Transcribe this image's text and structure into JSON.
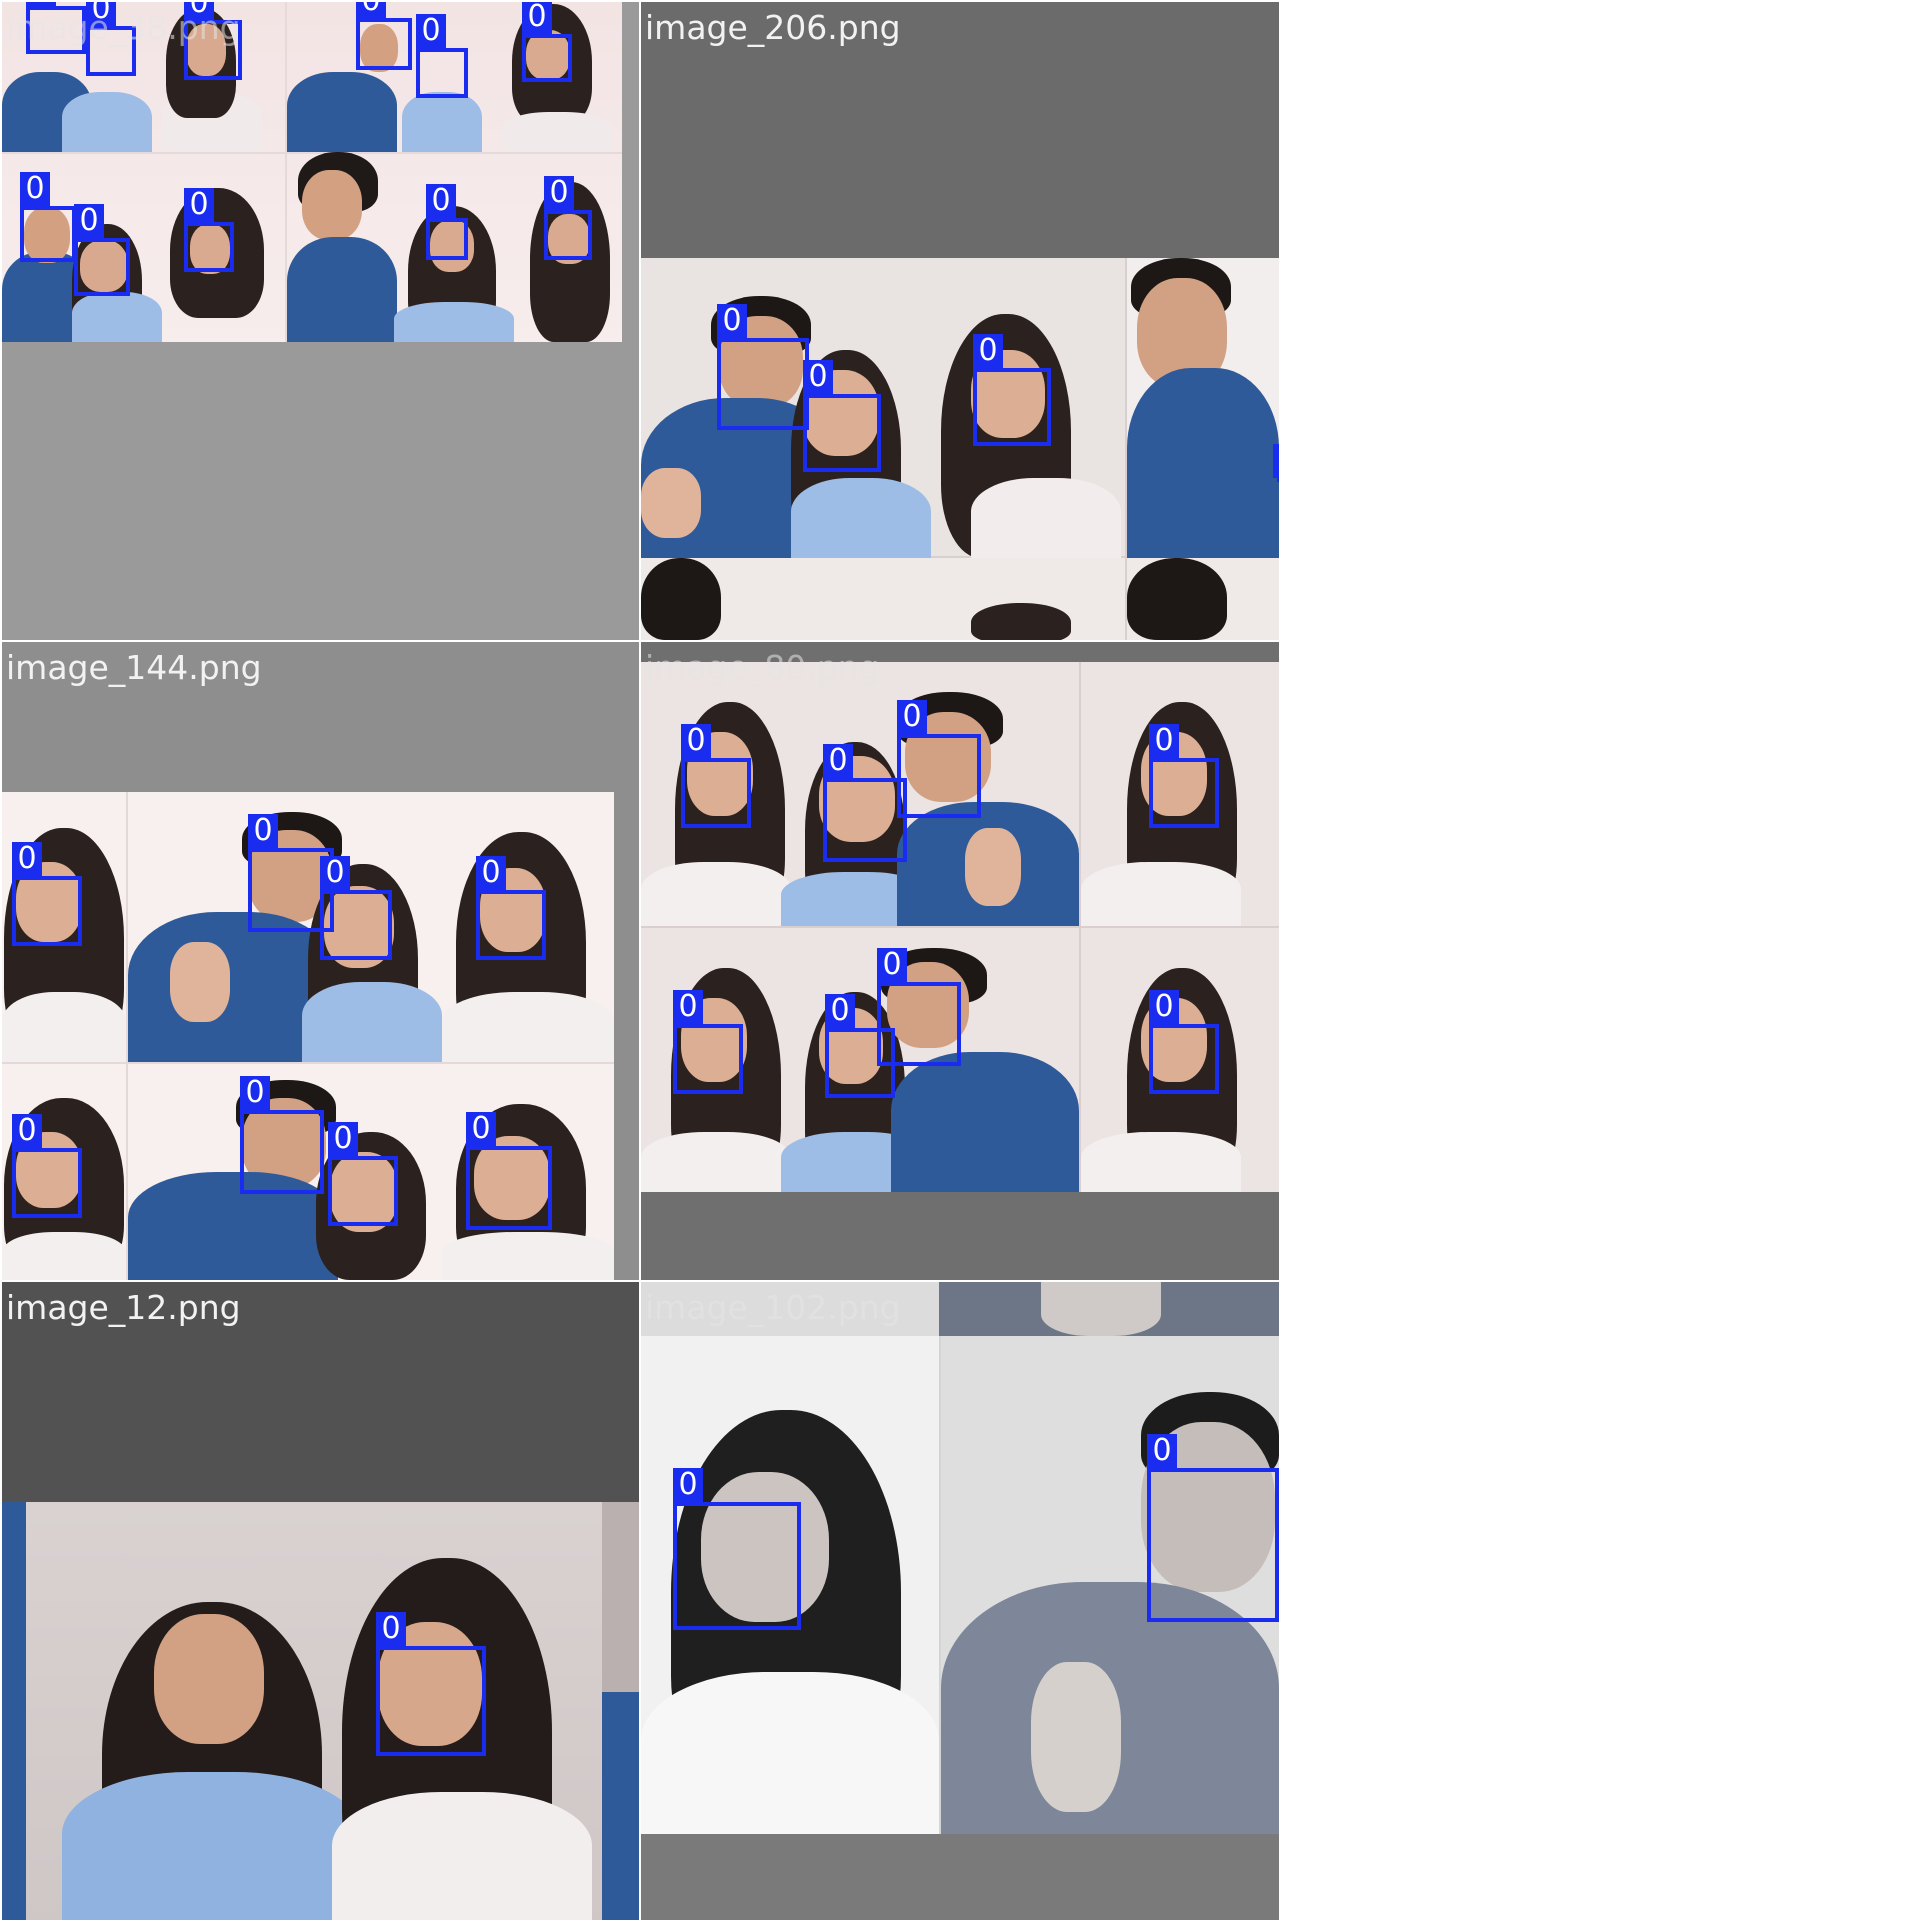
{
  "tiles": [
    {
      "name": "tile-image-38",
      "title": "image_38.png",
      "title_style": "faint",
      "bg": "#9a9a9a"
    },
    {
      "name": "tile-image-206",
      "title": "image_206.png",
      "title_style": "light",
      "bg": "#6b6b6b"
    },
    {
      "name": "tile-image-144",
      "title": "image_144.png",
      "title_style": "light",
      "bg": "#8e8e8e"
    },
    {
      "name": "tile-image-80",
      "title": "image_80.png",
      "title_style": "faint",
      "bg": "#6f6f6f"
    },
    {
      "name": "tile-image-12",
      "title": "image_12.png",
      "title_style": "light",
      "bg": "#525252"
    },
    {
      "name": "tile-image-102",
      "title": "image_102.png",
      "title_style": "faint",
      "bg": "#7a7a7a"
    }
  ],
  "detections": {
    "class_label": "0",
    "box_color": "#1a2cf0"
  }
}
